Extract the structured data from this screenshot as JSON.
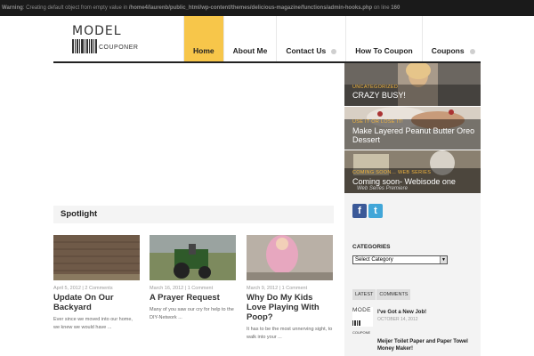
{
  "warning": {
    "label": "Warning",
    "message": ": Creating default object from empty value in",
    "path": "/home4/laurenb/public_html/wp-content/themes/delicious-magazine/functions/admin-hooks.php",
    "line_text": "on line",
    "line_no": "160"
  },
  "logo": {
    "top": "MODEL",
    "bottom": "COUPONER"
  },
  "nav": [
    {
      "label": "Home",
      "active": true,
      "dropdown": false
    },
    {
      "label": "About Me",
      "active": false,
      "dropdown": false
    },
    {
      "label": "Contact Us",
      "active": false,
      "dropdown": true
    },
    {
      "label": "How To Coupon",
      "active": false,
      "dropdown": false
    },
    {
      "label": "Coupons",
      "active": false,
      "dropdown": true
    }
  ],
  "featured": [
    {
      "category": "UNCATEGORIZED",
      "title": "CRAZY BUSY!"
    },
    {
      "category": "USE IT OR LOSE IT!",
      "title": "Make Layered Peanut Butter Oreo Dessert"
    },
    {
      "category": "COMING SOON... WEB SERIES",
      "title": "Coming soon- Webisode one",
      "overlay": "Web Series Premiere"
    }
  ],
  "spotlight": {
    "heading": "Spotlight",
    "posts": [
      {
        "date": "April 5, 2012",
        "comments": "2 Comments",
        "title": "Update On Our Backyard",
        "excerpt": "Ever since we moved into our home, we knew we would have ..."
      },
      {
        "date": "March 16, 2012",
        "comments": "1 Comment",
        "title": "A Prayer Request",
        "excerpt": "Many of you saw our cry for help to the DIY-Network ..."
      },
      {
        "date": "March 9, 2012",
        "comments": "1 Comment",
        "title": "Why Do My Kids Love Playing With Poop?",
        "excerpt": "It has to be the most unnerving sight, to walk into your ..."
      }
    ]
  },
  "sidebar": {
    "social": [
      {
        "icon": "facebook-icon",
        "glyph": "f",
        "color": "#3b5998"
      },
      {
        "icon": "twitter-icon",
        "glyph": "t",
        "color": "#41a6d8"
      }
    ],
    "categories_heading": "CATEGORIES",
    "categories_select": "Select Category",
    "tabs": [
      "LATEST",
      "COMMENTS"
    ],
    "latest": [
      {
        "title": "I've Got a New Job!",
        "date": "OCTOBER 14, 2012",
        "thumb_top": "MODE",
        "thumb_bottom": "COUPONE"
      },
      {
        "title": "Meijer Toilet Paper and Paper Towel Money Maker!",
        "date": ""
      }
    ]
  },
  "colors": {
    "accent": "#f7c64a",
    "category": "#f2b53e"
  }
}
